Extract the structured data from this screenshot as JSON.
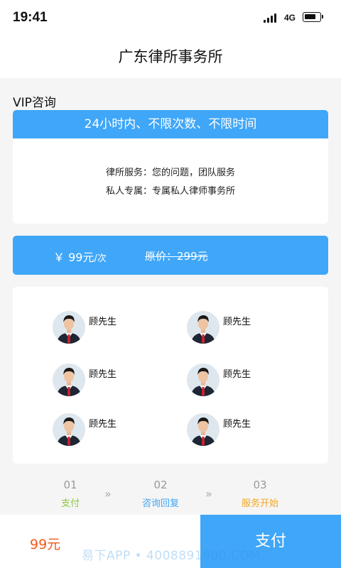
{
  "status_bar": {
    "time": "19:41",
    "network": "4G",
    "battery_level": 0.75
  },
  "nav": {
    "title": "广东律所事务所"
  },
  "section_title": "VIP咨询",
  "vip": {
    "banner": "24小时内、不限次数、不限时间",
    "line1": "律所服务：您的问题，团队服务",
    "line2": "私人专属：专属私人律师事务所"
  },
  "price": {
    "current": "￥ 99元",
    "unit": "/次",
    "original": "原价：299元"
  },
  "lawyers": [
    {
      "name": "顾先生"
    },
    {
      "name": "顾先生"
    },
    {
      "name": "顾先生"
    },
    {
      "name": "顾先生"
    },
    {
      "name": "顾先生"
    },
    {
      "name": "顾先生"
    }
  ],
  "steps": [
    {
      "num": "01",
      "label": "支付",
      "color": "#8dc63f"
    },
    {
      "num": "02",
      "label": "咨询回复",
      "color": "#3fa6f8"
    },
    {
      "num": "03",
      "label": "服务开始",
      "color": "#f5a623"
    }
  ],
  "step_arrow": "»",
  "footer": {
    "price": "99元",
    "pay_label": "支付",
    "watermark": "易下APP • 4008891800.COM"
  },
  "colors": {
    "accent": "#3fa6f8",
    "price": "#f35a1d"
  }
}
